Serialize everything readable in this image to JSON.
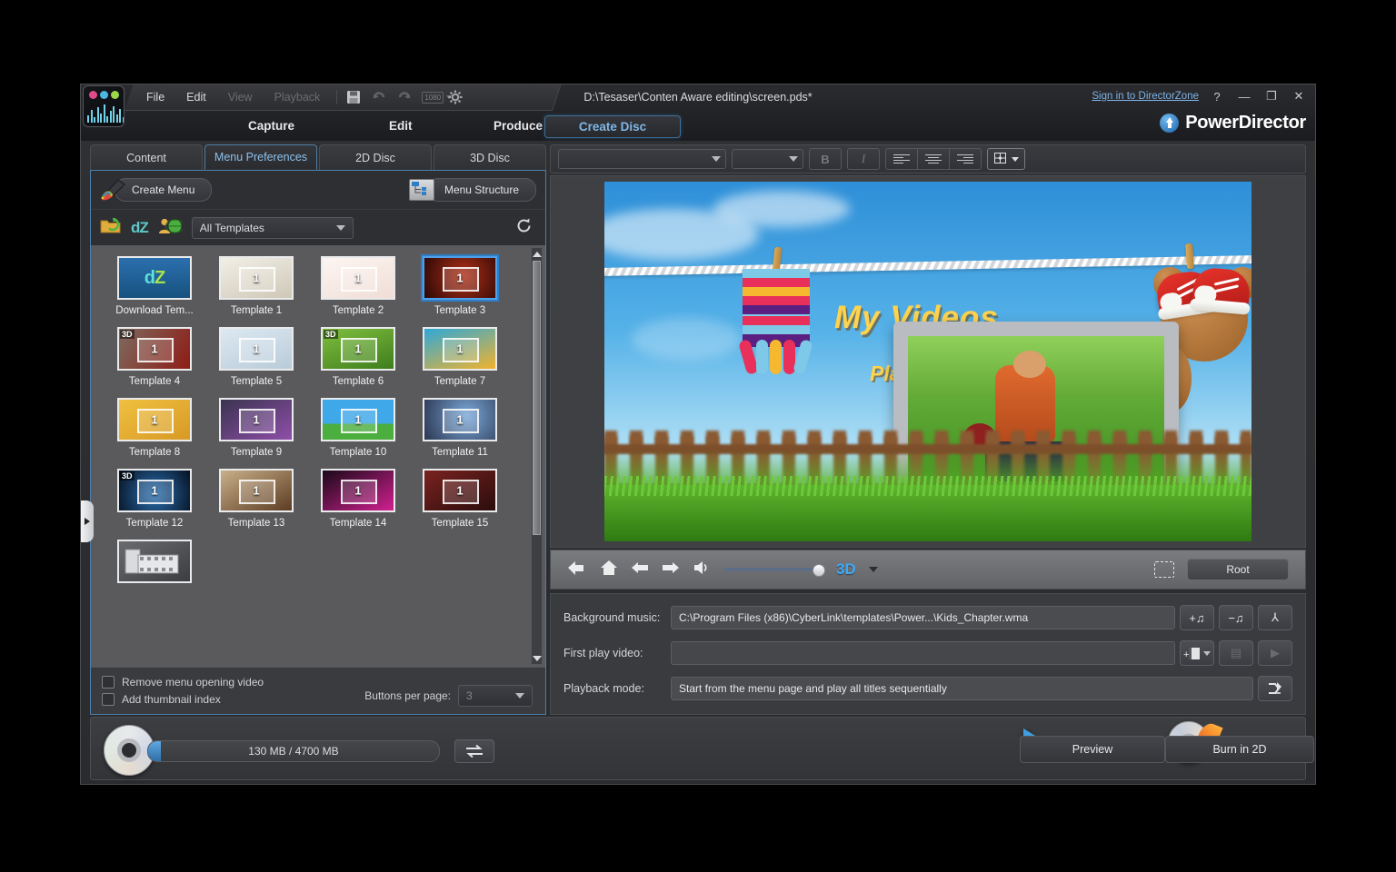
{
  "window": {
    "document_title": "D:\\Tesaser\\Conten Aware editing\\screen.pds*",
    "signin_label": "Sign in to DirectorZone",
    "help_label": "?",
    "minimize_label": "—",
    "restore_label": "❐",
    "close_label": "✕",
    "brand": "PowerDirector"
  },
  "menubar": {
    "items": [
      {
        "label": "File",
        "enabled": true
      },
      {
        "label": "Edit",
        "enabled": true
      },
      {
        "label": "View",
        "enabled": false
      },
      {
        "label": "Playback",
        "enabled": false
      }
    ],
    "icons": [
      "save-icon",
      "undo-icon",
      "redo-icon",
      "resolution-dropdown-icon",
      "settings-gear-icon"
    ],
    "resolution_label": "1080"
  },
  "nav": {
    "items": [
      {
        "label": "Capture",
        "active": false
      },
      {
        "label": "Edit",
        "active": false
      },
      {
        "label": "Produce",
        "active": false
      },
      {
        "label": "Create Disc",
        "active": true
      }
    ]
  },
  "tabs": [
    {
      "label": "Content",
      "active": false
    },
    {
      "label": "Menu Preferences",
      "active": true
    },
    {
      "label": "2D Disc",
      "active": false
    },
    {
      "label": "3D Disc",
      "active": false
    }
  ],
  "left_toolbar": {
    "create_menu_label": "Create Menu",
    "menu_structure_label": "Menu Structure",
    "filter_value": "All Templates",
    "dz_label": "dZ",
    "icons": [
      "import-folder-icon",
      "directorzone-icon",
      "member-globe-icon",
      "refresh-icon"
    ]
  },
  "templates": [
    {
      "label": "Download Tem...",
      "selected": false,
      "badge": "",
      "kind": "dz"
    },
    {
      "label": "Template 1",
      "selected": false,
      "badge": "",
      "kind": "light"
    },
    {
      "label": "Template 2",
      "selected": false,
      "badge": "",
      "kind": "pale"
    },
    {
      "label": "Template 3",
      "selected": true,
      "badge": "",
      "kind": "dark-red"
    },
    {
      "label": "Template 4",
      "selected": false,
      "badge": "3D",
      "kind": "car"
    },
    {
      "label": "Template 5",
      "selected": false,
      "badge": "",
      "kind": "pastel"
    },
    {
      "label": "Template 6",
      "selected": false,
      "badge": "3D",
      "kind": "green"
    },
    {
      "label": "Template 7",
      "selected": false,
      "badge": "",
      "kind": "ocean"
    },
    {
      "label": "Template 8",
      "selected": false,
      "badge": "",
      "kind": "yellow"
    },
    {
      "label": "Template 9",
      "selected": false,
      "badge": "",
      "kind": "purple"
    },
    {
      "label": "Template 10",
      "selected": false,
      "badge": "",
      "kind": "kids"
    },
    {
      "label": "Template 11",
      "selected": false,
      "badge": "",
      "kind": "blue-bokeh"
    },
    {
      "label": "Template 12",
      "selected": false,
      "badge": "3D",
      "kind": "navy"
    },
    {
      "label": "Template 13",
      "selected": false,
      "badge": "",
      "kind": "wood"
    },
    {
      "label": "Template 14",
      "selected": false,
      "badge": "",
      "kind": "neon"
    },
    {
      "label": "Template 15",
      "selected": false,
      "badge": "",
      "kind": "maroon"
    },
    {
      "label": "",
      "selected": false,
      "badge": "",
      "kind": "film"
    }
  ],
  "left_footer": {
    "remove_opening_video": "Remove menu opening video",
    "add_thumbnail_index": "Add thumbnail index",
    "buttons_per_page_label": "Buttons per page:",
    "buttons_per_page_value": "3"
  },
  "format_toolbar": {
    "font_family": "",
    "font_size": "",
    "bold_label": "B",
    "italic_label": "I",
    "icons": [
      "align-left-icon",
      "align-center-icon",
      "align-right-icon",
      "grid-align-icon"
    ]
  },
  "preview": {
    "menu_title": "My Videos",
    "play_button": "Play",
    "controls": {
      "back_label": "return-icon",
      "home_label": "home-icon",
      "prev_label": "previous-icon",
      "next_label": "next-icon",
      "volume_label": "volume-icon",
      "mode_3d": "3D",
      "root_label": "Root",
      "snapshot_label": "snapshot-icon"
    }
  },
  "settings": {
    "background_music_label": "Background music:",
    "background_music_value": "C:\\Program Files (x86)\\CyberLink\\templates\\Power...\\Kids_Chapter.wma",
    "first_play_video_label": "First play video:",
    "first_play_video_value": "",
    "playback_mode_label": "Playback mode:",
    "playback_mode_value": "Start from the menu page and play all titles sequentially",
    "buttons": {
      "add_music": "+♫",
      "remove_music": "−♫",
      "music_settings": "⅄",
      "add_video": "+▤",
      "edit_video": "▤",
      "play_video": "▶",
      "playback_settings": "⇆"
    }
  },
  "bottom_bar": {
    "capacity_text": "130 MB / 4700 MB",
    "swap_icon": "swap-disc-icon",
    "preview_label": "Preview",
    "burn_label": "Burn in 2D"
  },
  "colors": {
    "accent": "#7fb7e8",
    "selection": "#4ea1e8",
    "link": "#7fb3e8",
    "dz_teal": "#5fc8c8",
    "menu_title": "#ffd34d"
  }
}
